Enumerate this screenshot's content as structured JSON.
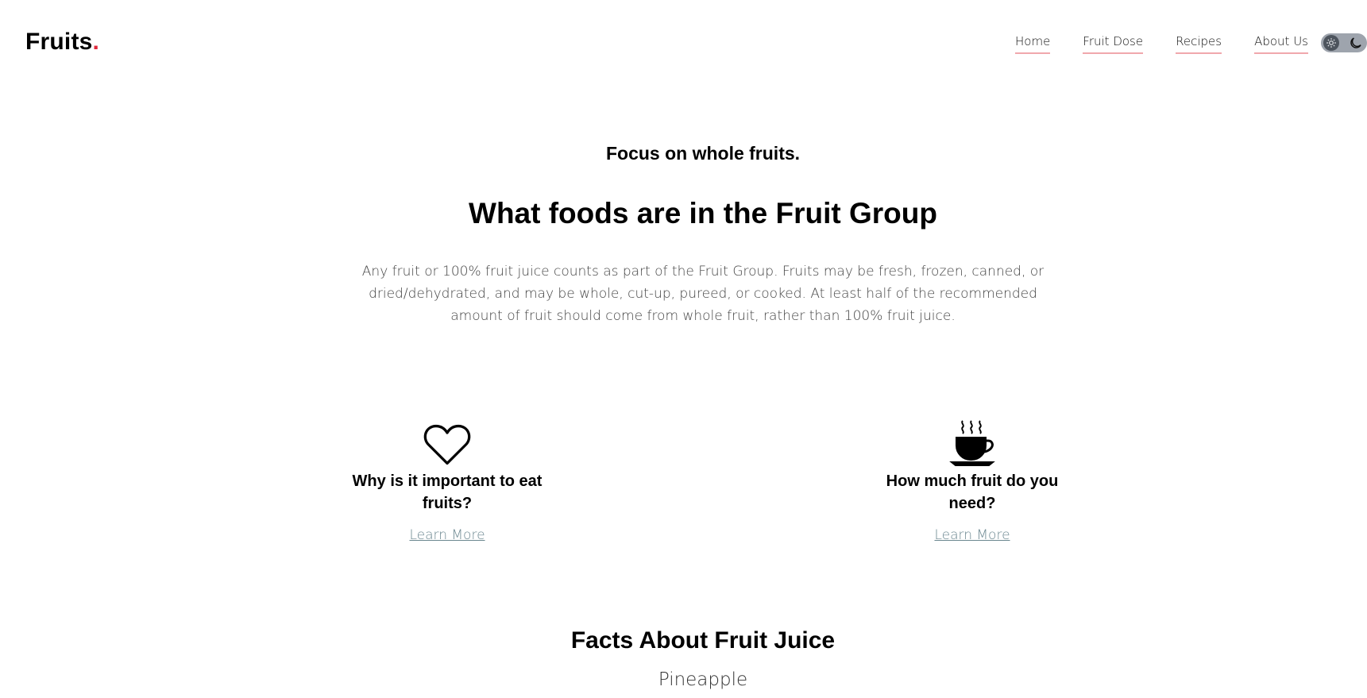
{
  "brand": {
    "name": "Fruits",
    "dot": "."
  },
  "nav": {
    "home": "Home",
    "fruit_dose": "Fruit Dose",
    "recipes": "Recipes",
    "about_us": "About Us"
  },
  "theme_toggle": {
    "light_icon": "sun-icon",
    "dark_icon": "moon-icon"
  },
  "hero": {
    "kicker": "Focus on whole fruits.",
    "title": "What foods are in the Fruit Group",
    "description": "Any fruit or 100% fruit juice counts as part of the Fruit Group. Fruits may be fresh, frozen, canned, or dried/dehydrated, and may be whole, cut-up, pureed, or cooked. At least half of the recommended amount of fruit should come from whole fruit, rather than 100% fruit juice."
  },
  "cards": [
    {
      "icon": "heart-icon",
      "heading": "Why is it important to eat fruits?",
      "link": "Learn More"
    },
    {
      "icon": "coffee-cup-icon",
      "heading": "How much fruit do you need?",
      "link": "Learn More"
    }
  ],
  "facts": {
    "title": "Facts About Fruit Juice",
    "subtitle": "Pineapple"
  },
  "colors": {
    "accent": "#e0283c",
    "nav_underline": "#f0a8ad",
    "link": "#6b8790",
    "toggle_bg": "#9ea4ad"
  }
}
